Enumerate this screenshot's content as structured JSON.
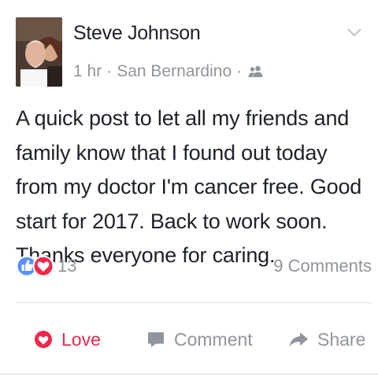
{
  "post": {
    "author": "Steve Johnson",
    "time": "1 hr",
    "separator": "·",
    "location": "San Bernardino",
    "audience_icon": "friends-icon",
    "menu_icon": "chevron-down-icon",
    "text": "A quick post to let all my friends and family know that I found out today from my doctor I'm cancer free. Good start for 2017. Back to work soon. Thanks everyone for caring."
  },
  "reactions": {
    "icons": [
      "like-icon",
      "love-icon"
    ],
    "count": "13",
    "comments": "9 Comments"
  },
  "actions": {
    "love": {
      "label": "Love",
      "icon": "love-outline-icon"
    },
    "comment": {
      "label": "Comment",
      "icon": "comment-icon"
    },
    "share": {
      "label": "Share",
      "icon": "share-icon"
    }
  },
  "colors": {
    "text": "#1d2129",
    "meta": "#90949c",
    "like_blue": "#5890ff",
    "love_red": "#f0284a",
    "divider": "#dddfe2"
  }
}
